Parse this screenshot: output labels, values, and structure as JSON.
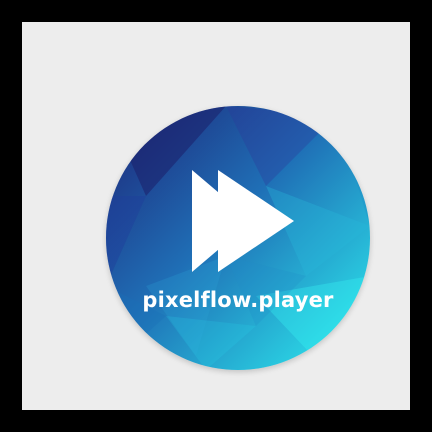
{
  "logo": {
    "label": "pixelflow.player",
    "icon": "fast-forward-icon",
    "colors": {
      "background": "#000000",
      "canvas": "#ededed",
      "gradient_dark": "#1f2d7a",
      "gradient_mid": "#1f7fc0",
      "gradient_light": "#27e6ee",
      "icon_fill": "#ffffff"
    }
  }
}
